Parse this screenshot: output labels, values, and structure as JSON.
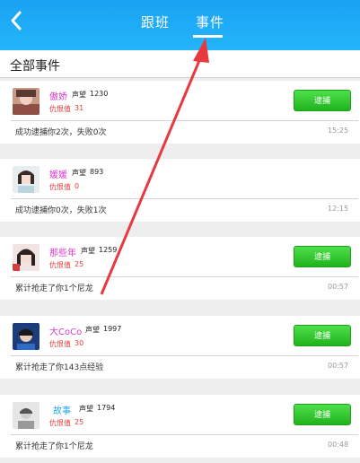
{
  "header": {
    "tabs": [
      {
        "label": "跟班"
      },
      {
        "label": "事件"
      }
    ]
  },
  "section": {
    "title": "全部事件"
  },
  "events": [
    {
      "name": "傲娇",
      "name_color": "#d63cc7",
      "reputation_label": "声望",
      "reputation": "1230",
      "hate_label": "仇恨值",
      "hate": "31",
      "catch_label": "逮捕",
      "text": "成功逮捕你2次，失败0次",
      "time": "15:25"
    },
    {
      "name": "媛媛",
      "name_color": "#d63cc7",
      "reputation_label": "声望",
      "reputation": "893",
      "hate_label": "仇恨值",
      "hate": "0",
      "catch_label": "",
      "text": "成功逮捕你0次，失败1次",
      "time": "12:15"
    },
    {
      "name": "那些年",
      "name_color": "#d63cc7",
      "reputation_label": "声望",
      "reputation": "1259",
      "hate_label": "仇恨值",
      "hate": "25",
      "catch_label": "逮捕",
      "text": "累计抢走了你1个尼龙",
      "time": "00:57"
    },
    {
      "name": "大CoCo",
      "name_color": "#d63cc7",
      "reputation_label": "声望",
      "reputation": "1997",
      "hate_label": "仇恨值",
      "hate": "30",
      "catch_label": "逮捕",
      "text": "累计抢走了你143点经验",
      "time": "00:57"
    },
    {
      "name": "故事",
      "name_color": "#25a8e8",
      "reputation_label": "声望",
      "reputation": "1794",
      "hate_label": "仇恨值",
      "hate": "25",
      "catch_label": "逮捕",
      "text": "累计抢走了你1个尼龙",
      "time": "00:48"
    }
  ],
  "colors": {
    "header": "#1fabf6",
    "button": "#2ebd29",
    "annotation_arrow": "#e8393f"
  }
}
